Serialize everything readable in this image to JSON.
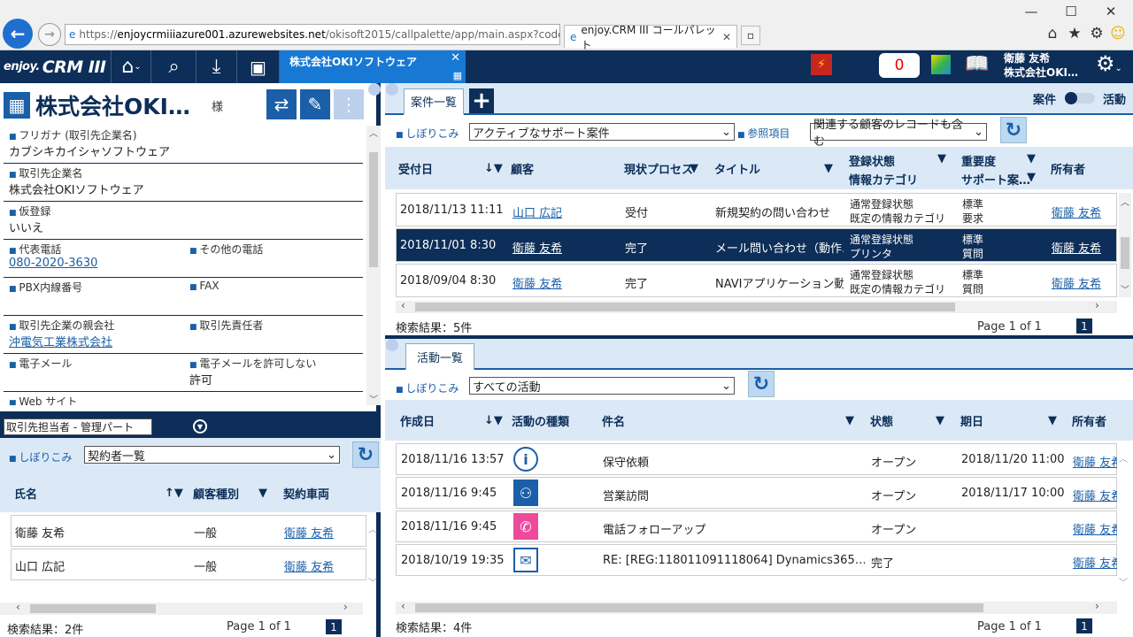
{
  "browser": {
    "url_prefix": "https://",
    "url_host": "enjoycrmiiiazure001.azurewebsites.net",
    "url_path": "/okisoft2015/callpalette/app/main.aspx?code",
    "tab_title": "enjoy.CRM III コールパレット"
  },
  "app": {
    "logo_small": "enjoy.",
    "logo_main": "CRM III",
    "open_tab": "株式会社OKIソフトウェア",
    "notification_count": "0",
    "user_name": "衛藤 友希",
    "user_company": "株式会社OKI…"
  },
  "account": {
    "title": "株式会社OKI…",
    "suffix": "様",
    "fields": [
      {
        "label": "フリガナ (取引先企業名)",
        "value": "カブシキカイシャソフトウェア"
      },
      {
        "label": "取引先企業名",
        "value": "株式会社OKIソフトウェア"
      },
      {
        "label": "仮登録",
        "value": "いいえ"
      },
      {
        "label": "代表電話",
        "value": "080-2020-3630",
        "label2": "その他の電話",
        "value2": ""
      },
      {
        "label": "PBX内線番号",
        "value": "",
        "label2": "FAX",
        "value2": ""
      },
      {
        "label": "取引先企業の親会社",
        "value": "沖電気工業株式会社",
        "label2": "取引先責任者",
        "value2": ""
      },
      {
        "label": "電子メール",
        "value": "",
        "label2": "電子メールを許可しない",
        "value2": "許可"
      },
      {
        "label": "Web サイト",
        "value": ""
      }
    ]
  },
  "contacts": {
    "view_select": "取引先担当者 - 管理パート",
    "filter_label": "しぼりこみ",
    "filter_value": "契約者一覧",
    "columns": [
      "氏名",
      "顧客種別",
      "契約車両"
    ],
    "rows": [
      {
        "name": "衛藤 友希",
        "type": "一般",
        "owner": "衛藤 友希"
      },
      {
        "name": "山口 広記",
        "type": "一般",
        "owner": "衛藤 友希"
      }
    ],
    "result": "検索結果：2件",
    "page": "Page 1 of 1",
    "page_num": "1"
  },
  "cases": {
    "tab": "案件一覧",
    "toggle_left": "案件",
    "toggle_right": "活動",
    "filter_label": "しぼりこみ",
    "filter_value": "アクティブなサポート案件",
    "ref_label": "参照項目",
    "ref_value": "関連する顧客のレコードも含む",
    "columns": [
      "受付日",
      "顧客",
      "現状プロセス",
      "タイトル",
      "登録状態",
      "情報カテゴリ",
      "重要度",
      "サポート案…",
      "所有者"
    ],
    "rows": [
      {
        "date": "2018/11/13 11:11",
        "customer": "山口 広記",
        "process": "受付",
        "title": "新規契約の問い合わせ",
        "status": "通常登録状態",
        "category": "既定の情報カテゴリ",
        "priority": "標準",
        "support": "要求",
        "owner": "衛藤 友希"
      },
      {
        "date": "2018/11/01 8:30",
        "customer": "衛藤 友希",
        "process": "完了",
        "title": "メール問い合わせ（動作…",
        "status": "通常登録状態",
        "category": "プリンタ",
        "priority": "標準",
        "support": "質問",
        "owner": "衛藤 友希"
      },
      {
        "date": "2018/09/04 8:30",
        "customer": "衛藤 友希",
        "process": "完了",
        "title": "NAVIアプリケーション動作…",
        "status": "通常登録状態",
        "category": "既定の情報カテゴリ",
        "priority": "標準",
        "support": "質問",
        "owner": "衛藤 友希"
      }
    ],
    "result": "検索結果：5件",
    "page": "Page 1 of 1",
    "page_num": "1"
  },
  "activities": {
    "tab": "活動一覧",
    "filter_label": "しぼりこみ",
    "filter_value": "すべての活動",
    "columns": [
      "作成日",
      "活動の種類",
      "件名",
      "状態",
      "期日",
      "所有者"
    ],
    "rows": [
      {
        "date": "2018/11/16 13:57",
        "icon": "info-icon",
        "subject": "保守依頼",
        "state": "オープン",
        "due": "2018/11/20 11:00",
        "owner": "衛藤 友希"
      },
      {
        "date": "2018/11/16 9:45",
        "icon": "visit-icon",
        "subject": "営業訪問",
        "state": "オープン",
        "due": "2018/11/17 10:00",
        "owner": "衛藤 友希"
      },
      {
        "date": "2018/11/16 9:45",
        "icon": "phone-icon",
        "subject": "電話フォローアップ",
        "state": "オープン",
        "due": "",
        "owner": "衛藤 友希"
      },
      {
        "date": "2018/10/19 19:35",
        "icon": "mail-icon",
        "subject": "RE: [REG:118011091118064] Dynamics365…",
        "state": "完了",
        "due": "",
        "owner": "衛藤 友希"
      }
    ],
    "result": "検索結果：4件",
    "page": "Page 1 of 1",
    "page_num": "1"
  },
  "colors": {
    "navy": "#0c2e58",
    "blue": "#1a5fa8",
    "accent": "#1779d4",
    "light": "#dbe9f7"
  }
}
